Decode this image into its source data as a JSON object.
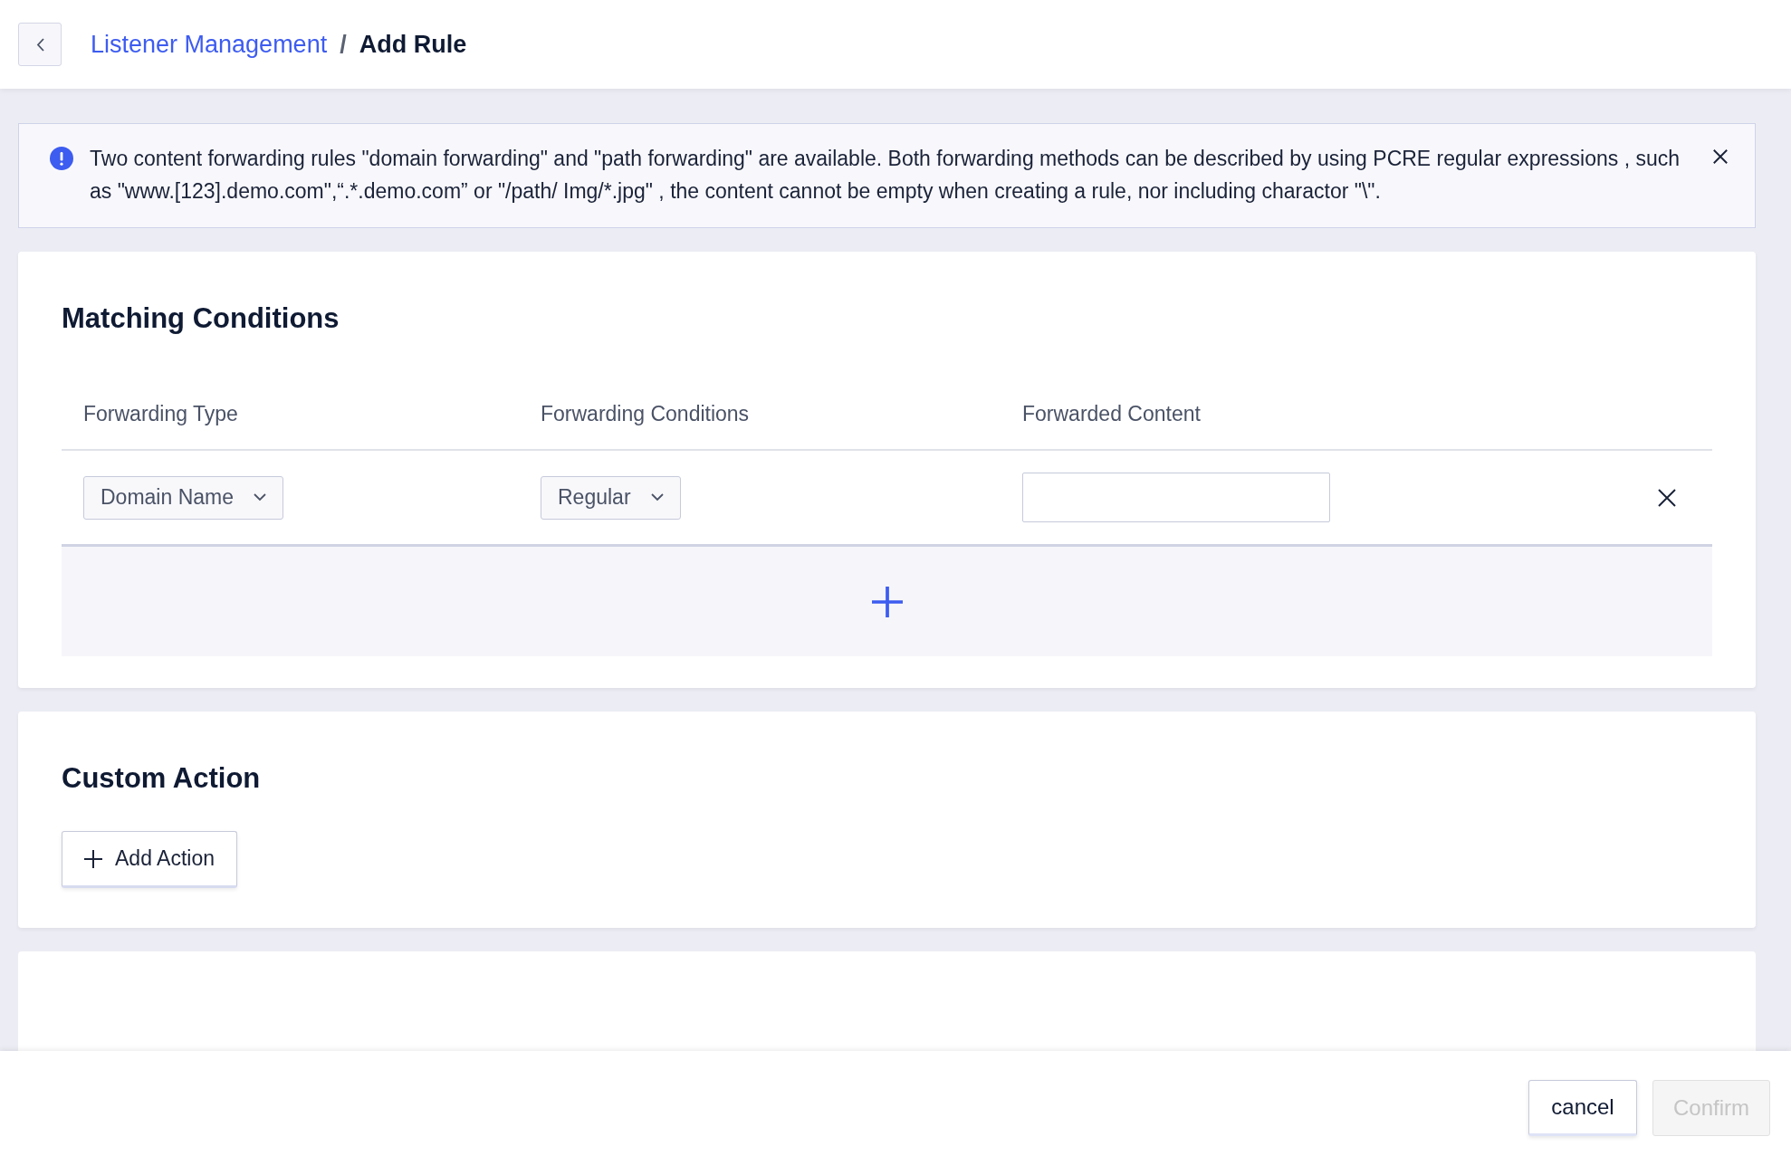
{
  "header": {
    "breadcrumb": [
      {
        "label": "Listener Management",
        "kind": "link"
      },
      {
        "label": "Add Rule",
        "kind": "current"
      }
    ],
    "separator": "/"
  },
  "notice": {
    "text": "Two content forwarding rules \"domain forwarding\" and \"path forwarding\" are available. Both forwarding methods can be described by using PCRE regular expressions , such as \"www.[123].demo.com\",“.*.demo.com” or \"/path/ Img/*.jpg\" , the content cannot be empty when creating a rule,  nor including charactor \"\\\"."
  },
  "matching_conditions": {
    "title": "Matching Conditions",
    "columns": [
      "Forwarding Type",
      "Forwarding Conditions",
      "Forwarded Content"
    ],
    "rows": [
      {
        "forwarding_type": "Domain Name",
        "forwarding_condition": "Regular"
      }
    ]
  },
  "custom_action": {
    "title": "Custom Action",
    "button": "Add Action"
  },
  "footer": {
    "buttons": [
      {
        "label": "cancel",
        "disabled": false
      },
      {
        "label": "Confirm",
        "disabled": true
      }
    ]
  }
}
